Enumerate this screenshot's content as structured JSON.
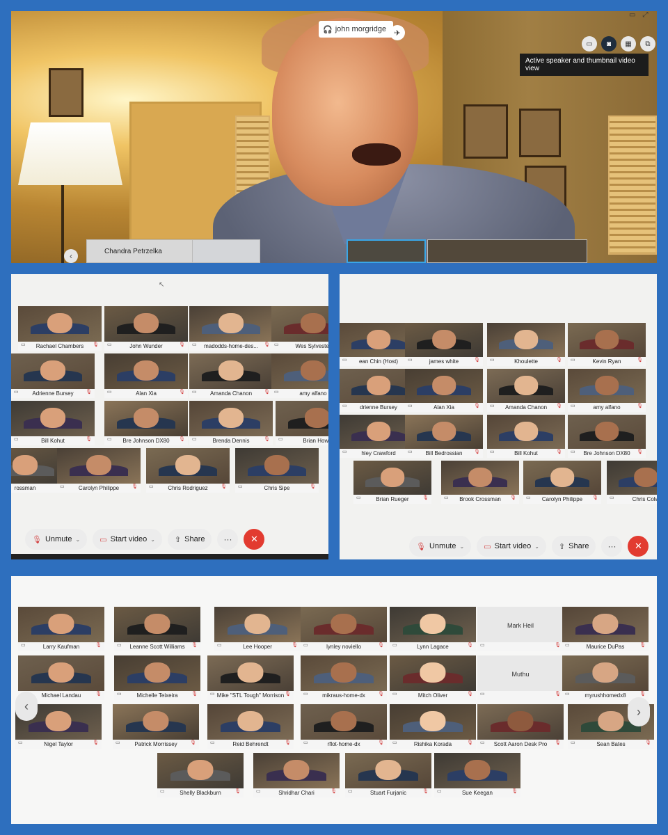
{
  "panel1": {
    "active_speaker": "john morgridge",
    "tooltip": "Active speaker and thumbnail video view",
    "strip_name": "Chandra Petrzelka",
    "view_icons": [
      "stage-icon",
      "speaker-thumbnail-icon",
      "grid-icon",
      "immersive-icon"
    ]
  },
  "panel2": {
    "rows": [
      [
        "Rachael Chambers",
        "John Wunder",
        "madodds-home-des...",
        "Wes Sylvester"
      ],
      [
        "Adrienne Bursey",
        "Alan Xia",
        "Amanda Chanon",
        "amy alfano"
      ],
      [
        "Bill Kohut",
        "Bre Johnson DX80",
        "Brenda Dennis",
        "Brian Howa"
      ],
      [
        "rossman",
        "Carolyn Philippe",
        "Chris Rodriguez",
        "Chris Sipe"
      ]
    ],
    "controls": {
      "unmute": "Unmute",
      "start_video": "Start video",
      "share": "Share",
      "more": "···",
      "leave": "✕"
    }
  },
  "panel3": {
    "rows": [
      [
        "ean Chin (Host)",
        "james white",
        "Khoulette",
        "Kevin Ryan"
      ],
      [
        "drienne Bursey",
        "Alan Xia",
        "Amanda Chanon",
        "amy alfano"
      ],
      [
        "hley Crawford",
        "Bill Bedrossian",
        "Bill Kohut",
        "Bre Johnson DX80"
      ],
      [
        "Brian Rueger",
        "Brook Crossman",
        "Carolyn Philippe",
        "Chris Colw"
      ]
    ],
    "controls": {
      "unmute": "Unmute",
      "start_video": "Start video",
      "share": "Share",
      "more": "···",
      "leave": "✕"
    }
  },
  "panel4": {
    "rows": [
      [
        "Larry Kaufman",
        "Leanne Scott Williams",
        "Lee Hooper",
        "lynley noviello",
        "Lynn Lagace",
        "Mark Heil",
        "Maurice DuPas"
      ],
      [
        "Michael Landau",
        "Michelle Teixeira",
        "Mike \"STL Tough\" Morrison",
        "mikraus-home-dx",
        "Mitch Oliver",
        "Muthu",
        "myrushhomedx8"
      ],
      [
        "Nigel Taylor",
        "Patrick Morrissey",
        "Reid Behrendt",
        "rflot-home-dx",
        "Rishika Korada",
        "Scott Aaron Desk Pro",
        "Sean Bates"
      ],
      [
        "Shelly Blackburn",
        "Shridhar Chari",
        "Stuart Furjanic",
        "Sue Keegan"
      ]
    ],
    "prev": "‹",
    "next": "›"
  }
}
